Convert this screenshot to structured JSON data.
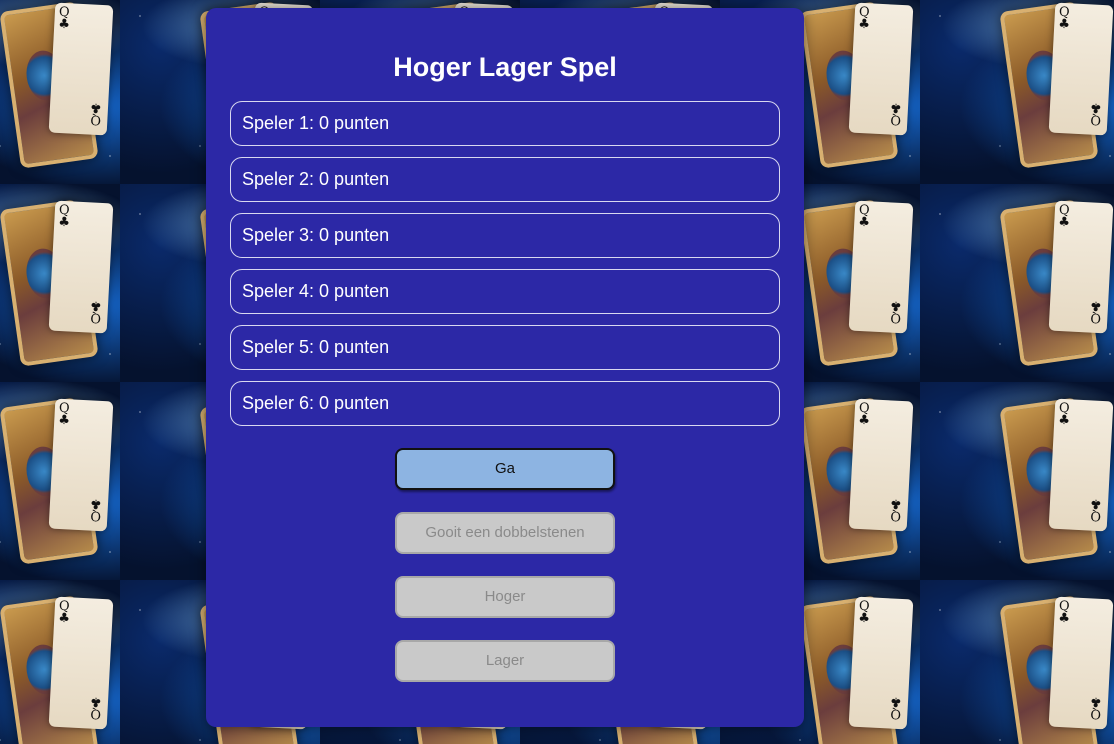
{
  "app": {
    "title": "Hoger Lager Spel"
  },
  "players": [
    {
      "label": "Speler 1: 0 punten"
    },
    {
      "label": "Speler 2: 0 punten"
    },
    {
      "label": "Speler 3: 0 punten"
    },
    {
      "label": "Speler 4: 0 punten"
    },
    {
      "label": "Speler 5: 0 punten"
    },
    {
      "label": "Speler 6: 0 punten"
    }
  ],
  "buttons": {
    "go": {
      "label": "Ga",
      "enabled": true
    },
    "roll": {
      "label": "Gooit een dobbelstenen",
      "enabled": false
    },
    "higher": {
      "label": "Hoger",
      "enabled": false
    },
    "lower": {
      "label": "Lager",
      "enabled": false
    }
  },
  "background": {
    "card_rank": "Q",
    "card_suit": "♣"
  },
  "colors": {
    "panel": "#2c28a6",
    "go_button": "#8db4e2",
    "disabled_button": "#c9c9c9"
  }
}
